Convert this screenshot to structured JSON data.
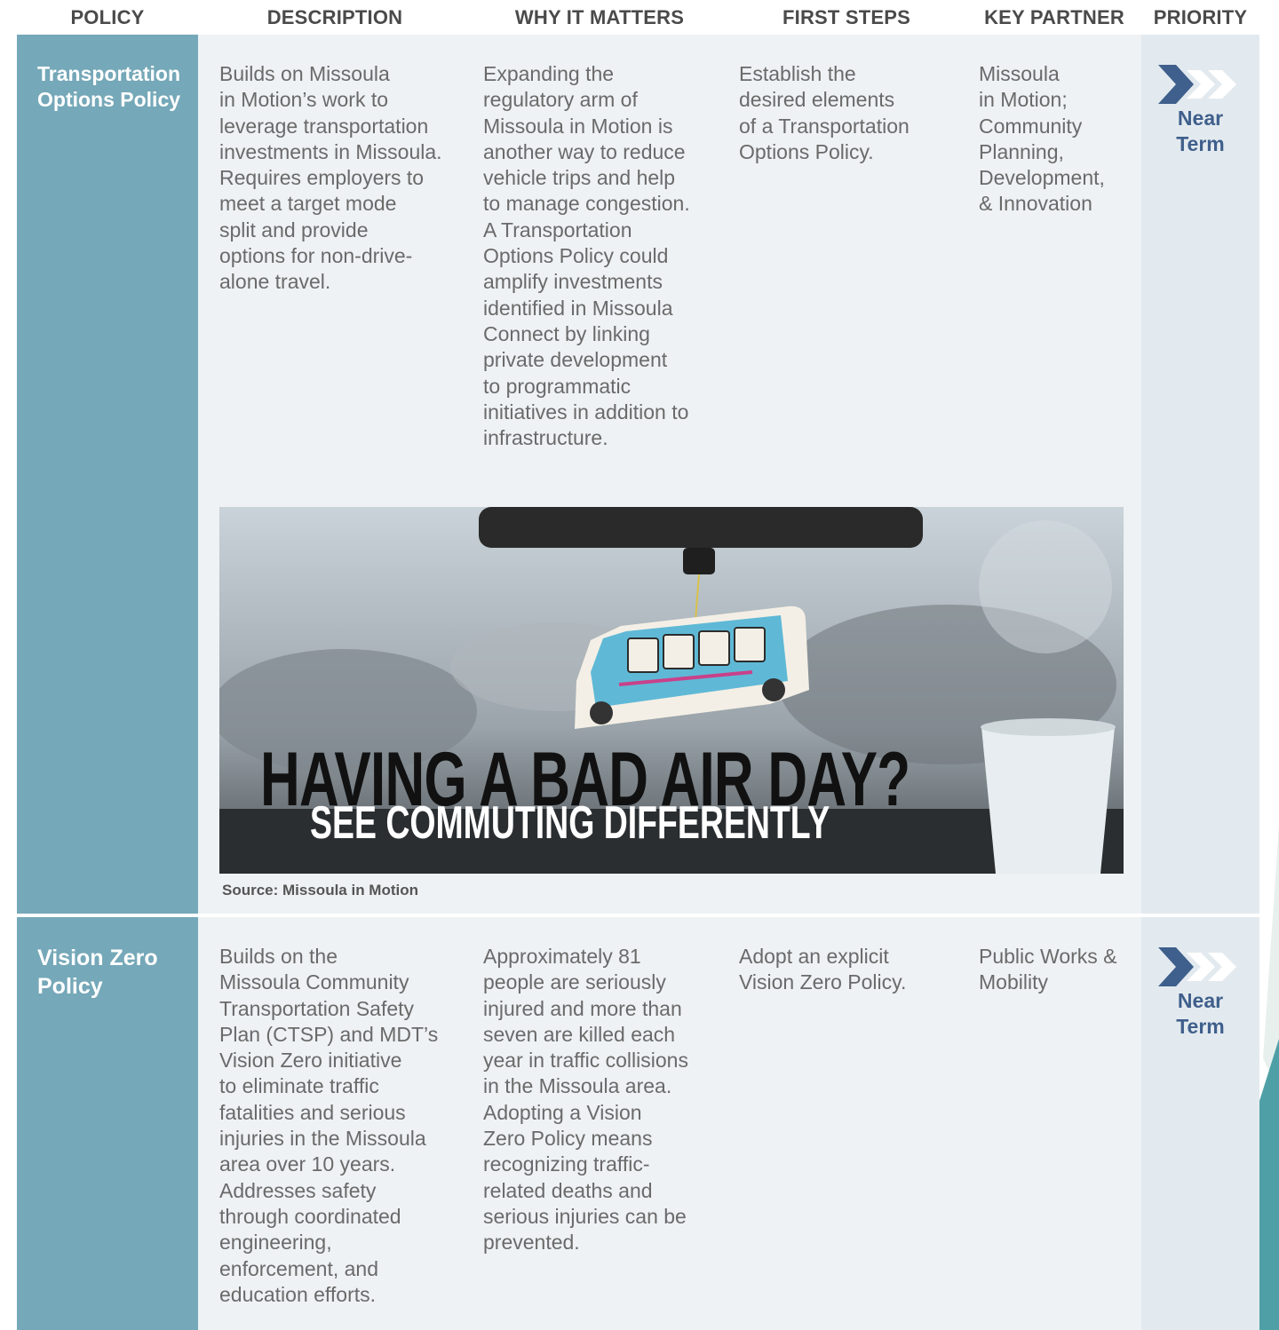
{
  "header": {
    "policy": "POLICY",
    "description": "DESCRIPTION",
    "why": "WHY IT MATTERS",
    "first_steps": "FIRST STEPS",
    "key_partner": "KEY PARTNER",
    "priority": "PRIORITY"
  },
  "rows": [
    {
      "policy": "Transportation Options Policy",
      "description": "Builds on Missoula\nin Motion’s work to\nleverage transportation\ninvestments in Missoula.\nRequires employers to\nmeet a target mode\nsplit and provide\noptions for non-drive-\nalone travel.",
      "why": "Expanding the\nregulatory arm of\nMissoula in Motion is\nanother way to reduce\nvehicle trips and help\nto manage congestion.\nA Transportation\nOptions Policy could\namplify investments\nidentified in Missoula\nConnect by linking\nprivate development\nto programmatic\ninitiatives in addition to\ninfrastructure.",
      "first_steps": "Establish the\ndesired elements\nof a Transportation\nOptions Policy.",
      "key_partner": "Missoula\nin Motion;\nCommunity\nPlanning,\nDevelopment,\n& Innovation",
      "priority": "Near\nTerm"
    },
    {
      "policy": "Vision Zero Policy",
      "description": "Builds on the\nMissoula Community\nTransportation Safety\nPlan (CTSP) and MDT’s\nVision Zero initiative\nto eliminate traffic\nfatalities and serious\ninjuries in the Missoula\narea over 10 years.\nAddresses safety\nthrough coordinated\nengineering,\nenforcement, and\neducation efforts.",
      "why": "Approximately 81\npeople are seriously\ninjured and more than\nseven are killed each\nyear in traffic collisions\nin the Missoula area.\nAdopting a Vision\nZero Policy means\nrecognizing traffic-\nrelated deaths and\nserious injuries can be\nprevented.",
      "first_steps": "Adopt an explicit\nVision Zero Policy.",
      "key_partner": "Public Works &\nMobility",
      "priority": "Near\nTerm"
    }
  ],
  "image": {
    "headline": "HAVING A BAD AIR DAY?",
    "subline": "SEE COMMUTING DIFFERENTLY",
    "caption": "Source: Missoula in Motion"
  },
  "colors": {
    "policy_column": "#75a8b8",
    "content_background": "#eef2f4",
    "priority_background": "#e3eaef",
    "priority_accent": "#3f5f8c"
  },
  "icons": {
    "priority": "chevron-arrows-icon"
  }
}
